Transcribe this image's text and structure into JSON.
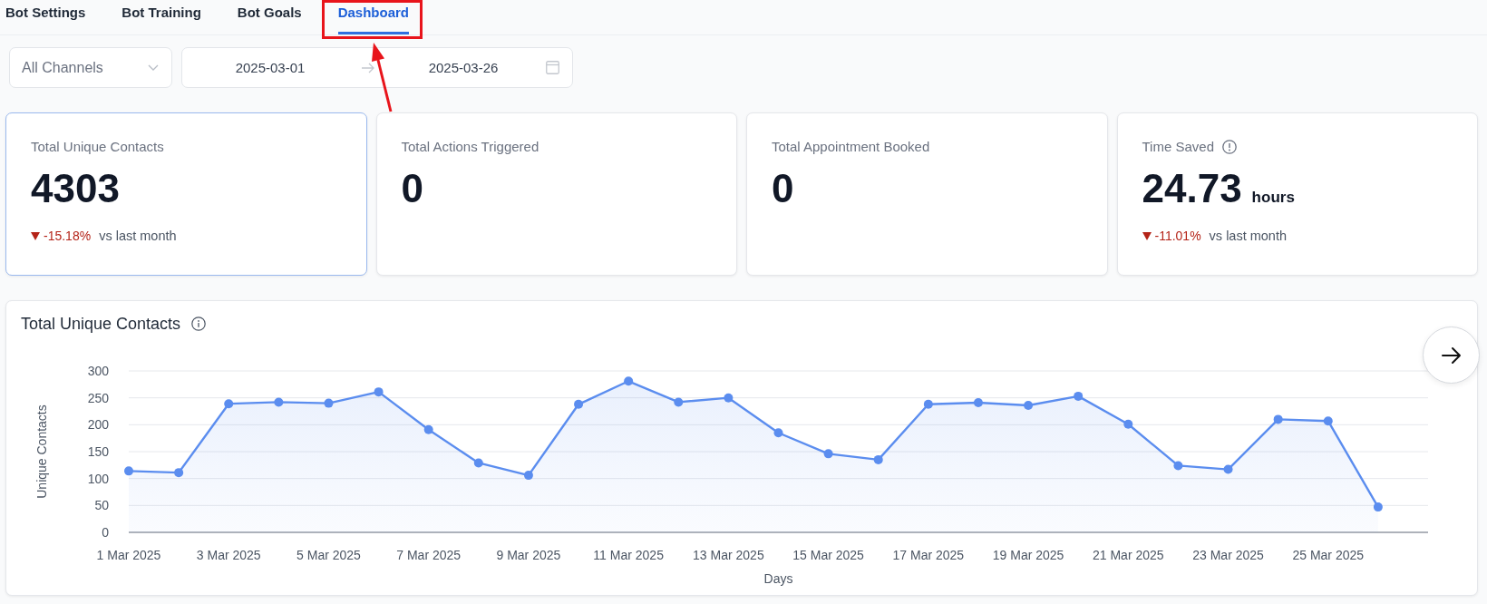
{
  "tabs": [
    {
      "label": "Bot Settings",
      "selected": false,
      "highlighted": false
    },
    {
      "label": "Bot Training",
      "selected": false,
      "highlighted": false
    },
    {
      "label": "Bot Goals",
      "selected": false,
      "highlighted": false
    },
    {
      "label": "Dashboard",
      "selected": true,
      "highlighted": true
    }
  ],
  "filters": {
    "channel_select": {
      "placeholder": "All Channels"
    },
    "date_range": {
      "start": "2025-03-01",
      "end": "2025-03-26"
    }
  },
  "cards": [
    {
      "label": "Total Unique Contacts",
      "value": "4303",
      "selected": true,
      "info": false,
      "change": {
        "text": "-15.18%",
        "negative": true,
        "comparison": "vs last month"
      }
    },
    {
      "label": "Total Actions Triggered",
      "value": "0",
      "selected": false,
      "info": false
    },
    {
      "label": "Total Appointment Booked",
      "value": "0",
      "selected": false,
      "info": false
    },
    {
      "label": "Time Saved",
      "value": "24.73",
      "unit": "hours",
      "selected": false,
      "info": true,
      "change": {
        "text": "-11.01%",
        "negative": true,
        "comparison": "vs last month"
      }
    }
  ],
  "chart_panel": {
    "info": true,
    "chart_data": {
      "type": "area",
      "title": "Total Unique Contacts",
      "xlabel": "Days",
      "ylabel": "Unique Contacts",
      "categories": [
        "1 Mar 2025",
        null,
        "3 Mar 2025",
        null,
        "5 Mar 2025",
        null,
        "7 Mar 2025",
        null,
        "9 Mar 2025",
        null,
        "11 Mar 2025",
        null,
        "13 Mar 2025",
        null,
        "15 Mar 2025",
        null,
        "17 Mar 2025",
        null,
        "19 Mar 2025",
        null,
        "21 Mar 2025",
        null,
        "23 Mar 2025",
        null,
        "25 Mar 2025",
        null
      ],
      "series": [
        {
          "color": "#5b8def",
          "values": [
            114,
            111,
            239,
            242,
            240,
            261,
            191,
            129,
            106,
            238,
            281,
            242,
            250,
            185,
            146,
            135,
            238,
            241,
            236,
            253,
            201,
            124,
            117,
            210,
            207,
            47
          ]
        }
      ],
      "ylim": [
        0,
        300
      ],
      "yticks": [
        0,
        50,
        100,
        150,
        200,
        250,
        300
      ],
      "grid": true
    }
  }
}
